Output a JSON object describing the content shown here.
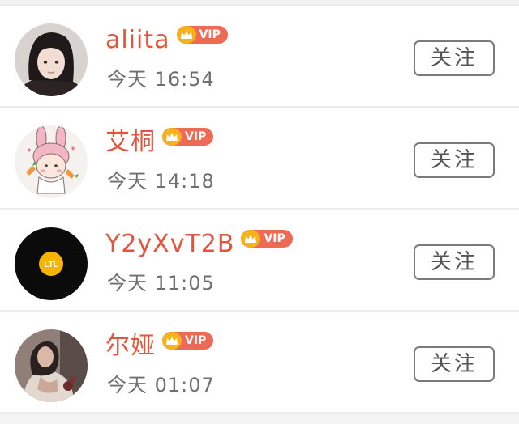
{
  "followers": [
    {
      "name": "aliita",
      "vip_label": "VIP",
      "time": "今天 16:54",
      "follow_label": "关注",
      "avatar": "girl-photo-avatar"
    },
    {
      "name": "艾桐",
      "vip_label": "VIP",
      "time": "今天 14:18",
      "follow_label": "关注",
      "avatar": "bunny-cartoon-avatar"
    },
    {
      "name": "Y2yXvT2B",
      "vip_label": "VIP",
      "time": "今天 11:05",
      "follow_label": "关注",
      "avatar": "ltl-logo-avatar",
      "avatar_text": "LTL"
    },
    {
      "name": "尔娅",
      "vip_label": "VIP",
      "time": "今天 01:07",
      "follow_label": "关注",
      "avatar": "woman-photo-avatar"
    }
  ],
  "colors": {
    "name": "#e0553c",
    "vip_badge": "#ee6a56",
    "crown": "#f6b21a",
    "time": "#6f6f6f",
    "button_border": "#7a7a7a"
  }
}
